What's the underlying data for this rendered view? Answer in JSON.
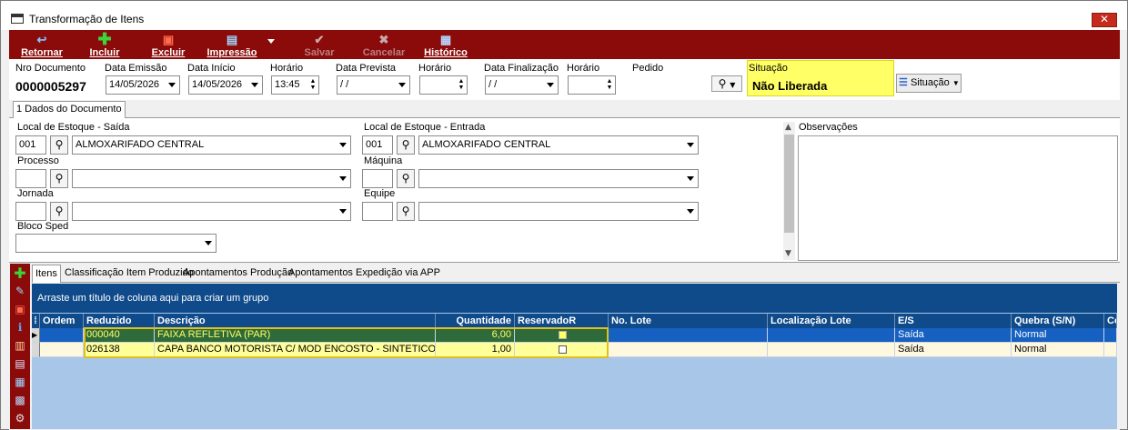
{
  "window": {
    "title": "Transformação de Itens",
    "close_glyph": "✕"
  },
  "toolbar": {
    "buttons": [
      {
        "label": "Retornar",
        "icon": "return-arrow-icon",
        "glyph": "↩"
      },
      {
        "label": "Incluir",
        "icon": "plus-icon",
        "glyph": "✚"
      },
      {
        "label": "Excluir",
        "icon": "delete-doc-icon",
        "glyph": "▣"
      },
      {
        "label": "Impressão",
        "icon": "printer-icon",
        "glyph": "▤"
      },
      {
        "label": "Salvar",
        "icon": "check-icon",
        "glyph": "✔",
        "disabled": true
      },
      {
        "label": "Cancelar",
        "icon": "x-icon",
        "glyph": "✖",
        "disabled": true
      },
      {
        "label": "Histórico",
        "icon": "history-doc-icon",
        "glyph": "▦"
      }
    ]
  },
  "header": {
    "nro_documento_label": "Nro Documento",
    "nro_documento": "0000005297",
    "data_emissao_label": "Data Emissão",
    "data_emissao": "14/05/2026",
    "data_inicio_label": "Data Início",
    "data_inicio": "14/05/2026",
    "horario_label": "Horário",
    "horario": "13:45",
    "data_prevista_label": "Data Prevista",
    "data_prevista": " / /",
    "horario2_label": "Horário",
    "horario2": "",
    "data_finalizacao_label": "Data Finalização",
    "data_finalizacao": " / /",
    "horario3_label": "Horário",
    "horario3": "",
    "pedido_label": "Pedido",
    "situacao_label": "Situação",
    "situacao": "Não Liberada",
    "situacao_button": "Situação"
  },
  "main_tabs": [
    {
      "label": "1 Dados do Documento"
    }
  ],
  "doc": {
    "local_saida_label": "Local de Estoque - Saída",
    "local_saida_code": "001",
    "local_saida_name": "ALMOXARIFADO CENTRAL",
    "local_entrada_label": "Local de Estoque - Entrada",
    "local_entrada_code": "001",
    "local_entrada_name": "ALMOXARIFADO CENTRAL",
    "processo_label": "Processo",
    "maquina_label": "Máquina",
    "jornada_label": "Jornada",
    "equipe_label": "Equipe",
    "bloco_sped_label": "Bloco Sped",
    "observacoes_label": "Observações"
  },
  "item_tabs": [
    {
      "label": "Itens"
    },
    {
      "label": "Classificação Item Produzido"
    },
    {
      "label": "Apontamentos Produção"
    },
    {
      "label": "Apontamentos Expedição via APP"
    }
  ],
  "grid": {
    "group_hint": "Arraste um título de coluna aqui para criar um grupo",
    "columns": [
      "Ordem",
      "Reduzido",
      "Descrição",
      "Quantidade",
      "ReservadoR",
      "No. Lote",
      "Localização Lote",
      "E/S",
      "Quebra (S/N)",
      "Co"
    ],
    "rows": [
      {
        "ordem": "",
        "reduzido": "000040",
        "descricao": "FAIXA REFLETIVA (PAR)",
        "quantidade": "6,00",
        "lote": "",
        "localizacao": "",
        "es": "Saída",
        "quebra": "Normal"
      },
      {
        "ordem": "",
        "reduzido": "026138",
        "descricao": "CAPA BANCO MOTORISTA C/ MOD ENCOSTO - SINTETICO PRETO",
        "quantidade": "1,00",
        "lote": "",
        "localizacao": "",
        "es": "Saída",
        "quebra": "Normal"
      }
    ]
  },
  "colors": {
    "toolbar": "#8b0a0a",
    "grid_header": "#0f4a8a",
    "highlight": "#ffff66",
    "selected_row": "#1560c0"
  }
}
